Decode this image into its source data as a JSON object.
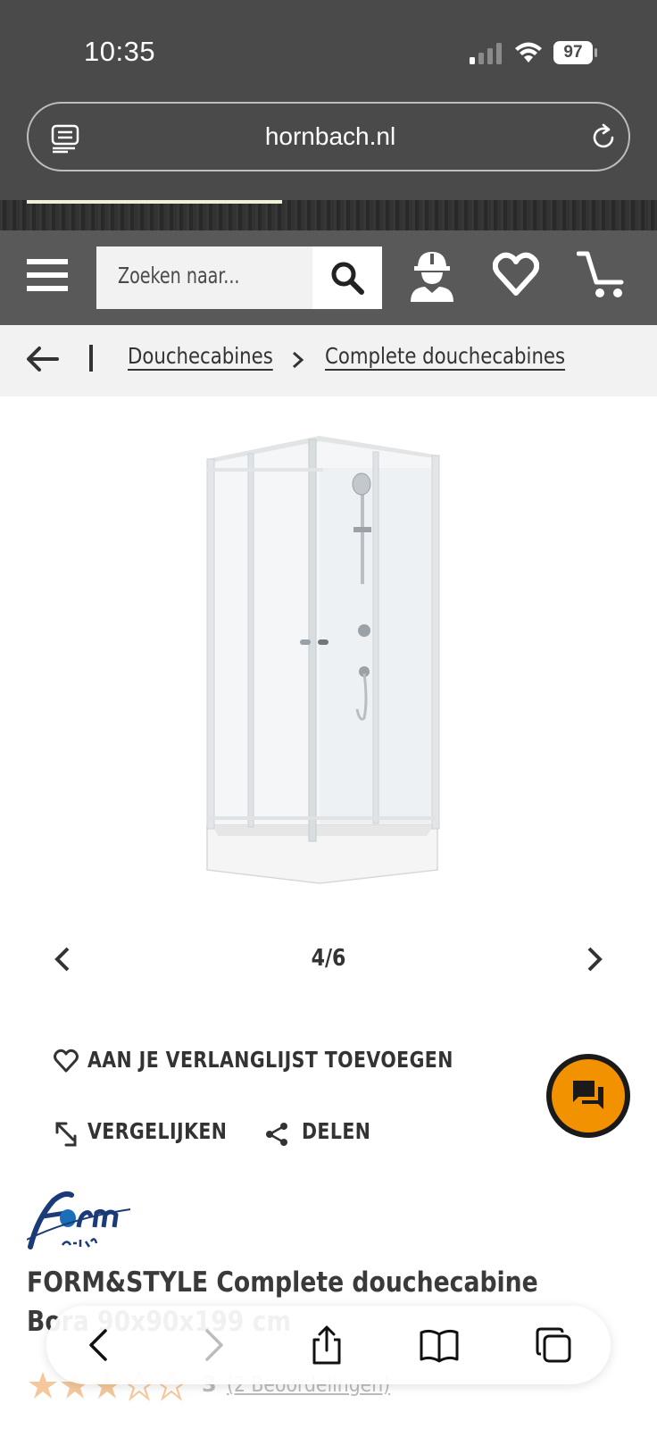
{
  "status_bar": {
    "time": "10:35",
    "battery": "97"
  },
  "browser": {
    "url": "hornbach.nl"
  },
  "header": {
    "search_placeholder": "Zoeken naar..."
  },
  "breadcrumb": {
    "items": [
      {
        "label": "Douchecabines"
      },
      {
        "label": "Complete douchecabines"
      }
    ]
  },
  "gallery": {
    "counter": "4/6",
    "current": 4,
    "total": 6
  },
  "actions": {
    "wishlist_label": "AAN JE VERLANGLIJST TOEVOEGEN",
    "compare_label": "VERGELIJKEN",
    "share_label": "DELEN"
  },
  "product": {
    "brand_logo_text": "form & style",
    "title": "FORM&STYLE Complete douchecabine Bora 90x90x199 cm",
    "rating_value": "3",
    "rating_stars": 3,
    "rating_max": 5,
    "reviews_label": "(2 Beoordelingen)"
  },
  "colors": {
    "brand_orange": "#f39200",
    "header_gray": "#595959",
    "topbar_gray": "#4a4a4a"
  }
}
